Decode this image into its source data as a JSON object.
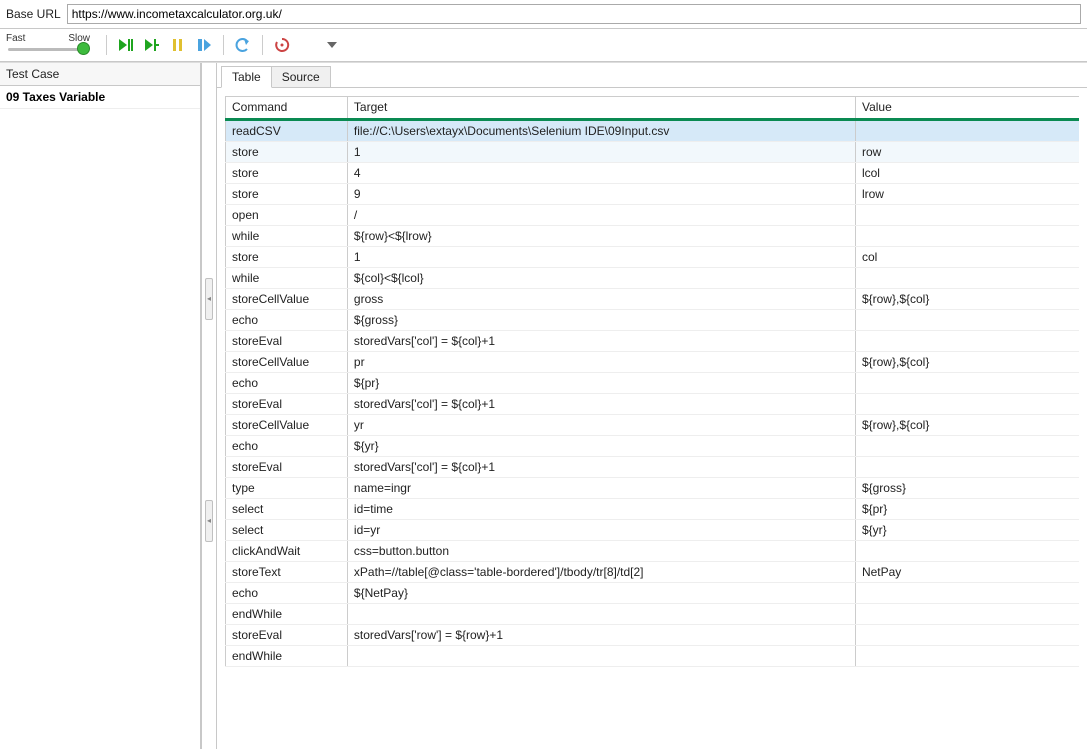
{
  "baseurl": {
    "label": "Base URL",
    "value": "https://www.incometaxcalculator.org.uk/"
  },
  "speed": {
    "fast": "Fast",
    "slow": "Slow"
  },
  "sidebar": {
    "header": "Test Case",
    "item": "09 Taxes Variable"
  },
  "tabs": {
    "table": "Table",
    "source": "Source"
  },
  "columns": {
    "cmd": "Command",
    "tgt": "Target",
    "val": "Value"
  },
  "rows": [
    {
      "cmd": "readCSV",
      "tgt": "file://C:\\Users\\extayx\\Documents\\Selenium IDE\\09Input.csv",
      "val": "",
      "sel": "selected"
    },
    {
      "cmd": "store",
      "tgt": "1",
      "val": "row",
      "sel": "soft"
    },
    {
      "cmd": "store",
      "tgt": "4",
      "val": "lcol",
      "sel": ""
    },
    {
      "cmd": "store",
      "tgt": "9",
      "val": "lrow",
      "sel": ""
    },
    {
      "cmd": "open",
      "tgt": "/",
      "val": "",
      "sel": ""
    },
    {
      "cmd": "while",
      "tgt": "${row}<${lrow}",
      "val": "",
      "sel": ""
    },
    {
      "cmd": "store",
      "tgt": "1",
      "val": "col",
      "sel": ""
    },
    {
      "cmd": "while",
      "tgt": "${col}<${lcol}",
      "val": "",
      "sel": ""
    },
    {
      "cmd": "storeCellValue",
      "tgt": "gross",
      "val": "${row},${col}",
      "sel": ""
    },
    {
      "cmd": "echo",
      "tgt": "${gross}",
      "val": "",
      "sel": ""
    },
    {
      "cmd": "storeEval",
      "tgt": "storedVars['col'] = ${col}+1",
      "val": "",
      "sel": ""
    },
    {
      "cmd": "storeCellValue",
      "tgt": "pr",
      "val": "${row},${col}",
      "sel": ""
    },
    {
      "cmd": "echo",
      "tgt": "${pr}",
      "val": "",
      "sel": ""
    },
    {
      "cmd": "storeEval",
      "tgt": "storedVars['col'] = ${col}+1",
      "val": "",
      "sel": ""
    },
    {
      "cmd": "storeCellValue",
      "tgt": "yr",
      "val": "${row},${col}",
      "sel": ""
    },
    {
      "cmd": "echo",
      "tgt": "${yr}",
      "val": "",
      "sel": ""
    },
    {
      "cmd": "storeEval",
      "tgt": "storedVars['col'] = ${col}+1",
      "val": "",
      "sel": ""
    },
    {
      "cmd": "type",
      "tgt": "name=ingr",
      "val": "${gross}",
      "sel": ""
    },
    {
      "cmd": "select",
      "tgt": "id=time",
      "val": "${pr}",
      "sel": ""
    },
    {
      "cmd": "select",
      "tgt": "id=yr",
      "val": "${yr}",
      "sel": ""
    },
    {
      "cmd": "clickAndWait",
      "tgt": "css=button.button",
      "val": "",
      "sel": ""
    },
    {
      "cmd": "storeText",
      "tgt": "xPath=//table[@class='table-bordered']/tbody/tr[8]/td[2]",
      "val": "NetPay",
      "sel": ""
    },
    {
      "cmd": "echo",
      "tgt": "${NetPay}",
      "val": "",
      "sel": ""
    },
    {
      "cmd": "endWhile",
      "tgt": "",
      "val": "",
      "sel": ""
    },
    {
      "cmd": "storeEval",
      "tgt": "storedVars['row'] = ${row}+1",
      "val": "",
      "sel": ""
    },
    {
      "cmd": "endWhile",
      "tgt": "",
      "val": "",
      "sel": ""
    }
  ]
}
